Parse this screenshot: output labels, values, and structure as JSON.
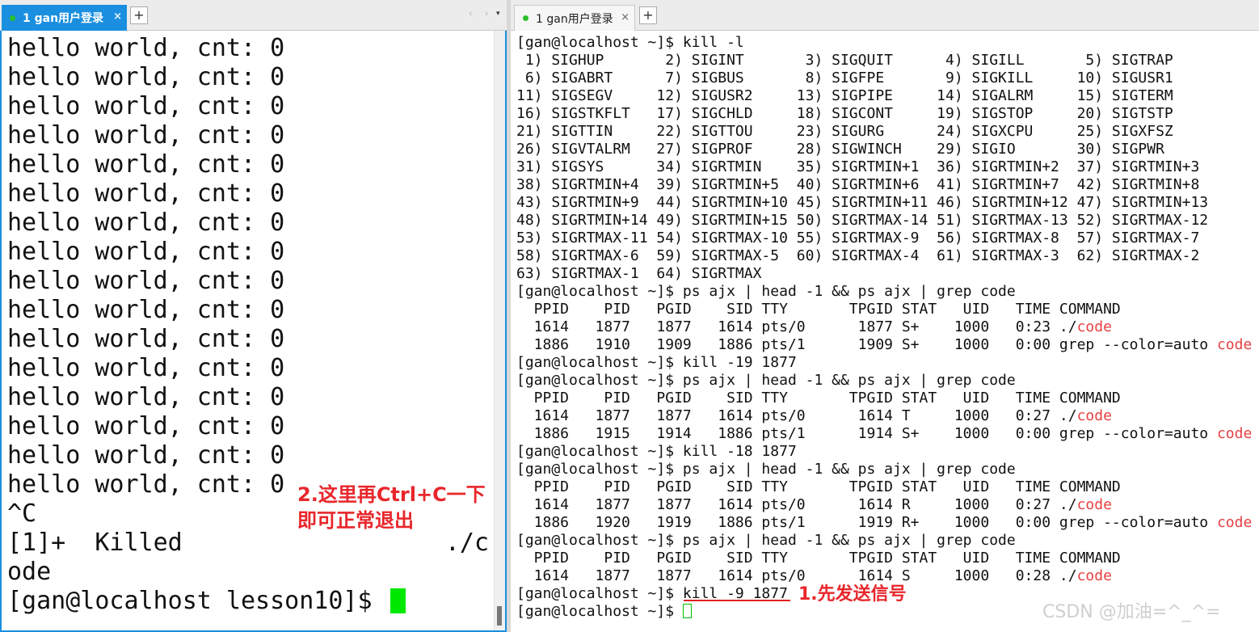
{
  "left_tabbar": {
    "tab_label": "1 gan用户登录",
    "close_symbol": "×",
    "add_symbol": "+",
    "nav_arrows": "‹ ›",
    "dropdown_symbol": "▾"
  },
  "right_tabbar": {
    "tab_label": "1 gan用户登录",
    "close_symbol": "×",
    "add_symbol": "+"
  },
  "left_terminal": {
    "output_lines": [
      "hello world, cnt: 0",
      "hello world, cnt: 0",
      "hello world, cnt: 0",
      "hello world, cnt: 0",
      "hello world, cnt: 0",
      "hello world, cnt: 0",
      "hello world, cnt: 0",
      "hello world, cnt: 0",
      "hello world, cnt: 0",
      "hello world, cnt: 0",
      "hello world, cnt: 0",
      "hello world, cnt: 0",
      "hello world, cnt: 0",
      "hello world, cnt: 0",
      "hello world, cnt: 0",
      "hello world, cnt: 0",
      "^C",
      "[1]+  Killed                  ./c",
      "ode"
    ],
    "prompt": "[gan@localhost lesson10]$ "
  },
  "right_terminal": {
    "lines": [
      "[gan@localhost ~]$ kill -l",
      " 1) SIGHUP       2) SIGINT       3) SIGQUIT      4) SIGILL       5) SIGTRAP",
      " 6) SIGABRT      7) SIGBUS       8) SIGFPE       9) SIGKILL     10) SIGUSR1",
      "11) SIGSEGV     12) SIGUSR2     13) SIGPIPE     14) SIGALRM     15) SIGTERM",
      "16) SIGSTKFLT   17) SIGCHLD     18) SIGCONT     19) SIGSTOP     20) SIGTSTP",
      "21) SIGTTIN     22) SIGTTOU     23) SIGURG      24) SIGXCPU     25) SIGXFSZ",
      "26) SIGVTALRM   27) SIGPROF     28) SIGWINCH    29) SIGIO       30) SIGPWR",
      "31) SIGSYS      34) SIGRTMIN    35) SIGRTMIN+1  36) SIGRTMIN+2  37) SIGRTMIN+3",
      "38) SIGRTMIN+4  39) SIGRTMIN+5  40) SIGRTMIN+6  41) SIGRTMIN+7  42) SIGRTMIN+8",
      "43) SIGRTMIN+9  44) SIGRTMIN+10 45) SIGRTMIN+11 46) SIGRTMIN+12 47) SIGRTMIN+13",
      "48) SIGRTMIN+14 49) SIGRTMIN+15 50) SIGRTMAX-14 51) SIGRTMAX-13 52) SIGRTMAX-12",
      "53) SIGRTMAX-11 54) SIGRTMAX-10 55) SIGRTMAX-9  56) SIGRTMAX-8  57) SIGRTMAX-7",
      "58) SIGRTMAX-6  59) SIGRTMAX-5  60) SIGRTMAX-4  61) SIGRTMAX-3  62) SIGRTMAX-2",
      "63) SIGRTMAX-1  64) SIGRTMAX",
      "[gan@localhost ~]$ ps ajx | head -1 && ps ajx | grep code",
      "  PPID    PID   PGID    SID TTY       TPGID STAT   UID   TIME COMMAND",
      [
        "  1614   1877   1877   1614 pts/0      1877 S+    1000   0:23 ./",
        "code"
      ],
      [
        "  1886   1910   1909   1886 pts/1      1909 S+    1000   0:00 grep --color=auto ",
        "code"
      ],
      "[gan@localhost ~]$ kill -19 1877",
      "[gan@localhost ~]$ ps ajx | head -1 && ps ajx | grep code",
      "  PPID    PID   PGID    SID TTY       TPGID STAT   UID   TIME COMMAND",
      [
        "  1614   1877   1877   1614 pts/0      1614 T     1000   0:27 ./",
        "code"
      ],
      [
        "  1886   1915   1914   1886 pts/1      1914 S+    1000   0:00 grep --color=auto ",
        "code"
      ],
      "[gan@localhost ~]$ kill -18 1877",
      "[gan@localhost ~]$ ps ajx | head -1 && ps ajx | grep code",
      "  PPID    PID   PGID    SID TTY       TPGID STAT   UID   TIME COMMAND",
      [
        "  1614   1877   1877   1614 pts/0      1614 R     1000   0:27 ./",
        "code"
      ],
      [
        "  1886   1920   1919   1886 pts/1      1919 R+    1000   0:00 grep --color=auto ",
        "code"
      ],
      "[gan@localhost ~]$ ps ajx | head -1 && ps ajx | grep code",
      "  PPID    PID   PGID    SID TTY       TPGID STAT   UID   TIME COMMAND",
      [
        "  1614   1877   1877   1614 pts/0      1614 S     1000   0:28 ./",
        "code"
      ],
      "[gan@localhost ~]$ kill -9 1877",
      "[gan@localhost ~]$ "
    ]
  },
  "annotations": {
    "left_line1": "2.这里再Ctrl+C一下",
    "left_line2": "即可正常退出",
    "right": "1.先发送信号"
  },
  "watermark": "CSDN @加油=^_^=",
  "colors": {
    "tab_active": "#1a8fe0",
    "highlight_text": "#e84040",
    "annotation": "#e8262b",
    "cursor": "#00e800"
  }
}
